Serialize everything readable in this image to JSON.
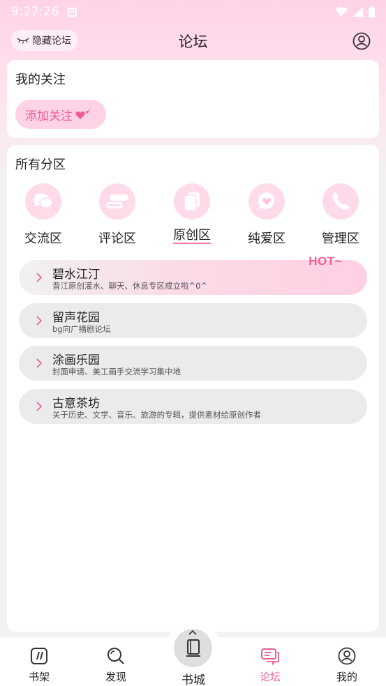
{
  "status_bar": {
    "time": "9:27:26",
    "badge": "A"
  },
  "header": {
    "hide_label": "隐藏论坛",
    "title": "论坛"
  },
  "follow": {
    "title": "我的关注",
    "add_label": "添加关注"
  },
  "sections": {
    "title": "所有分区",
    "zones": [
      {
        "label": "交流区",
        "icon": "chat-bubbles-icon"
      },
      {
        "label": "评论区",
        "icon": "comment-icon"
      },
      {
        "label": "原创区",
        "icon": "documents-icon",
        "active": true
      },
      {
        "label": "纯爱区",
        "icon": "heart-bubble-icon"
      },
      {
        "label": "管理区",
        "icon": "phone-icon"
      }
    ],
    "hot_tag": "HOT~",
    "forums": [
      {
        "name": "碧水江汀",
        "desc": "晋江原创灌水、聊天、休息专区成立啦^0^"
      },
      {
        "name": "留声花园",
        "desc": "bg向广播剧论坛"
      },
      {
        "name": "涂画乐园",
        "desc": "封面申请、美工画手交流学习集中地"
      },
      {
        "name": "古意茶坊",
        "desc": "关于历史、文学、音乐、旅游的专辑，提供素材给原创作者"
      }
    ]
  },
  "nav": {
    "items": [
      {
        "label": "书架",
        "icon": "bookshelf-icon"
      },
      {
        "label": "发现",
        "icon": "search-icon"
      },
      {
        "label": "书城",
        "icon": "book-icon"
      },
      {
        "label": "论坛",
        "icon": "forum-icon",
        "active": true
      },
      {
        "label": "我的",
        "icon": "user-icon"
      }
    ]
  },
  "colors": {
    "accent": "#ef5d97",
    "pink_light": "#ffd3e6",
    "zone_bg": "#ffdbe9"
  }
}
